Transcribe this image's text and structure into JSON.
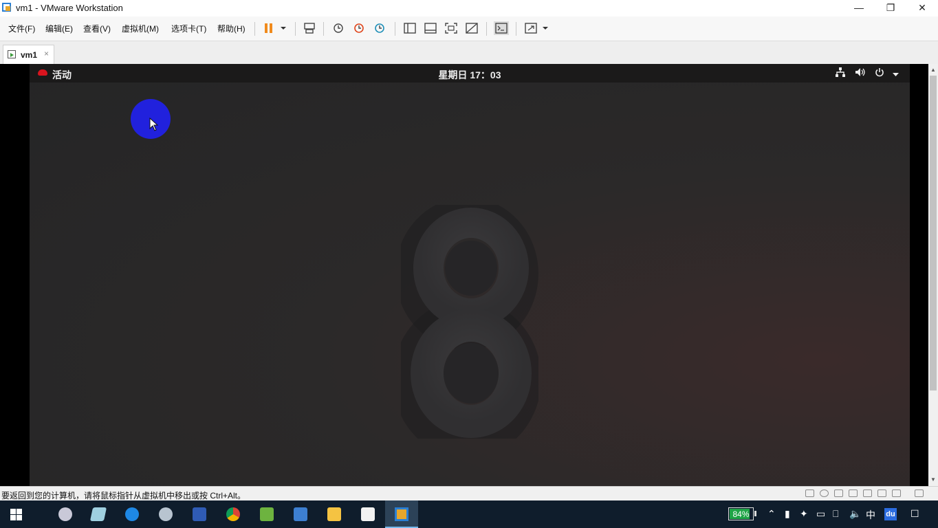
{
  "window": {
    "title": "vm1 - VMware Workstation"
  },
  "menu": [
    {
      "label": "文件(F)"
    },
    {
      "label": "编辑(E)"
    },
    {
      "label": "查看(V)"
    },
    {
      "label": "虚拟机(M)"
    },
    {
      "label": "选项卡(T)"
    },
    {
      "label": "帮助(H)"
    }
  ],
  "toolbar": [
    "pause-icon",
    "dropdown-arrow-icon",
    "send-ctrl-alt-del-icon",
    "snapshot-take-icon",
    "snapshot-revert-icon",
    "snapshot-manager-icon",
    "library-view-icon",
    "thumbnail-bar-icon",
    "fullscreen-icon",
    "unity-icon",
    "console-view-icon",
    "stretch-view-icon"
  ],
  "tabs": [
    {
      "label": "vm1",
      "close": "×"
    }
  ],
  "guest": {
    "activities": "活动",
    "clock": "星期日 17：03",
    "logo_text": "8"
  },
  "status": {
    "message": "要返回到您的计算机，请将鼠标指针从虚拟机中移出或按 Ctrl+Alt。"
  },
  "taskbar": {
    "battery_percent": 84,
    "battery_text": "84%",
    "ime": "中",
    "du": "du",
    "apps": [
      "paint-app-icon",
      "notes-app-icon",
      "edge-icon",
      "settings-app-icon",
      "visio-icon",
      "chrome-icon",
      "text-editor-icon",
      "control-panel-icon",
      "file-explorer-icon",
      "typora-icon",
      "vmware-icon"
    ]
  },
  "colors": {
    "accent": "#2121dd",
    "redhat": "#d9141e",
    "battery": "#1ea446",
    "taskbar": "#0f1d2c"
  }
}
